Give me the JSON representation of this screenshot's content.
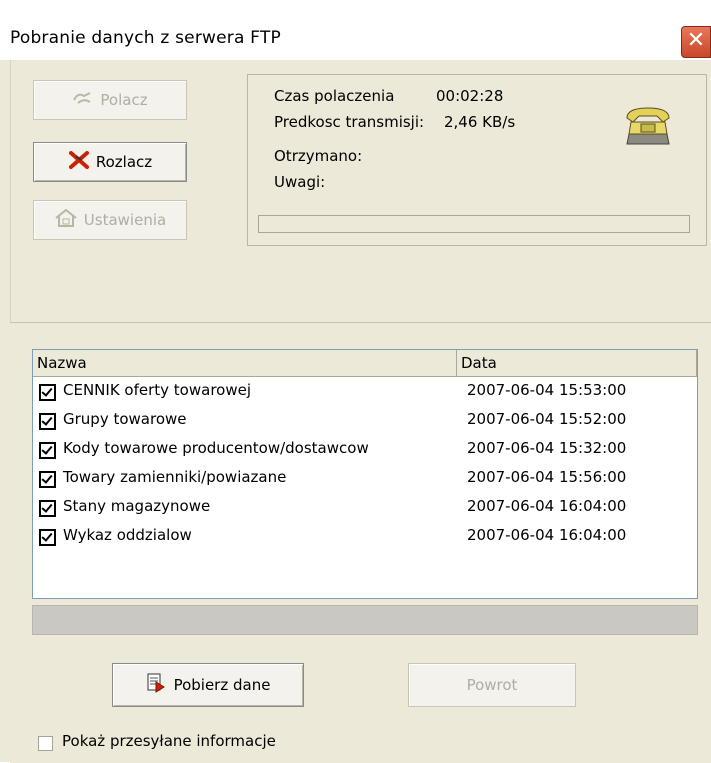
{
  "window": {
    "title": "Pobranie danych z serwera FTP",
    "close_label": "✕"
  },
  "buttons": {
    "connect": "Polacz",
    "disconnect": "Rozlacz",
    "settings": "Ustawienia",
    "download": "Pobierz dane",
    "back": "Powrot"
  },
  "info": {
    "connection_time_label": "Czas polaczenia",
    "connection_time_value": "00:02:28",
    "speed_label": "Predkosc transmisji:",
    "speed_value": "2,46 KB/s",
    "received_label": "Otrzymano:",
    "notes_label": "Uwagi:"
  },
  "list": {
    "columns": [
      "Nazwa",
      "Data"
    ],
    "rows": [
      {
        "name": "CENNIK oferty towarowej",
        "date": "2007-06-04 15:53:00",
        "checked": true
      },
      {
        "name": "Grupy towarowe",
        "date": "2007-06-04 15:52:00",
        "checked": true
      },
      {
        "name": "Kody towarowe producentow/dostawcow",
        "date": "2007-06-04 15:32:00",
        "checked": true
      },
      {
        "name": "Towary zamienniki/powiazane",
        "date": "2007-06-04 15:56:00",
        "checked": true
      },
      {
        "name": "Stany magazynowe",
        "date": "2007-06-04 16:04:00",
        "checked": true
      },
      {
        "name": "Wykaz oddzialow",
        "date": "2007-06-04 16:04:00",
        "checked": true
      }
    ]
  },
  "options": {
    "show_info_label": "Pokaż przesyłane informacje",
    "show_info_checked": false
  },
  "colors": {
    "window_bg": "#ece9d8",
    "close_button": "#d4573a",
    "disconnect_icon": "#cc2200"
  }
}
